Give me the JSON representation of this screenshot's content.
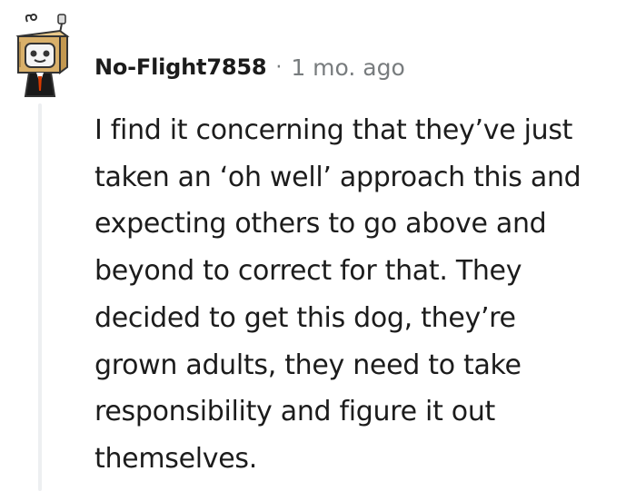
{
  "comment": {
    "author": "No-Flight7858",
    "separator": "·",
    "time_ago": "1 mo. ago",
    "avatar_icon": "snoo-avatar-box-head-icon",
    "body": "I find it concerning that they’ve just\ntaken an ‘oh well’ approach this and\nexpecting others to go above and\nbeyond to correct for that. They\ndecided to get this dog, they’re\ngrown adults, they need to take\nresponsibility and figure it out\nthemselves."
  },
  "colors": {
    "text": "#1c1c1c",
    "meta": "#787c7e",
    "thread_line": "#edeff1"
  }
}
